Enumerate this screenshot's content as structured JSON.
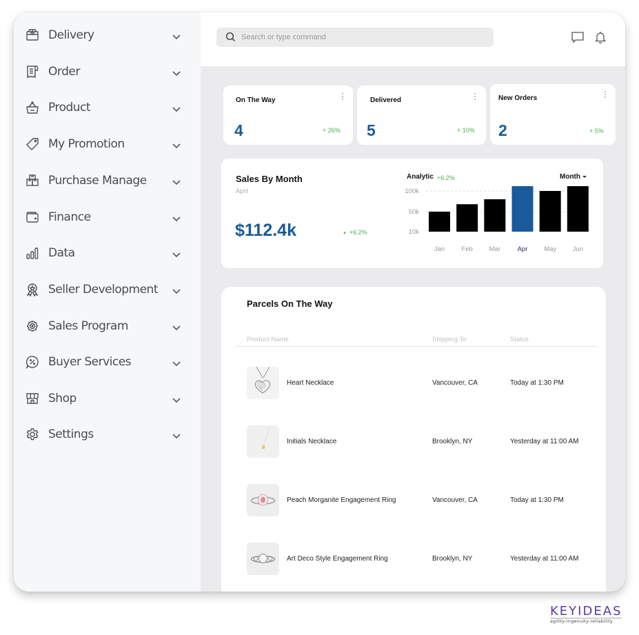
{
  "sidebar": {
    "items": [
      {
        "label": "Delivery",
        "icon": "box-icon"
      },
      {
        "label": "Order",
        "icon": "receipt-icon"
      },
      {
        "label": "Product",
        "icon": "basket-icon"
      },
      {
        "label": "My Promotion",
        "icon": "tag-icon"
      },
      {
        "label": "Purchase Manage",
        "icon": "boxes-icon"
      },
      {
        "label": "Finance",
        "icon": "wallet-icon"
      },
      {
        "label": "Data",
        "icon": "bar-chart-icon"
      },
      {
        "label": "Seller Development",
        "icon": "badge-icon"
      },
      {
        "label": "Sales Program",
        "icon": "target-gear-icon"
      },
      {
        "label": "Buyer Services",
        "icon": "percent-chat-icon"
      },
      {
        "label": "Shop",
        "icon": "store-icon"
      },
      {
        "label": "Settings",
        "icon": "gear-icon"
      }
    ]
  },
  "topbar": {
    "search_placeholder": "Search or type command"
  },
  "stats": [
    {
      "title": "On The Way",
      "value": "4",
      "change": "+ 26%"
    },
    {
      "title": "Delivered",
      "value": "5",
      "change": "+ 10%"
    },
    {
      "title": "New Orders",
      "value": "2",
      "change": "+ 5%"
    }
  ],
  "sales": {
    "title": "Sales By Month",
    "subtitle": "April",
    "value": "$112.4k",
    "change": "+6.2%",
    "analytic_label": "Analytic",
    "analytic_change": "+6.2%",
    "period": "Month"
  },
  "chart_data": {
    "type": "bar",
    "title": "Analytic",
    "categories": [
      "Jan",
      "Feb",
      "Mar",
      "Apr",
      "May",
      "Jun"
    ],
    "values": [
      50,
      68,
      80,
      115,
      100,
      115
    ],
    "unit": "k",
    "highlight": "Apr",
    "y_ticks": [
      "10k",
      "50k",
      "100k"
    ],
    "y_tick_values": [
      10,
      50,
      100
    ],
    "ylim": [
      10,
      115
    ],
    "grid": "dashed at 50k and 100k",
    "colors": {
      "bar": "#000000",
      "highlight": "#1a5a9a",
      "highlight_label": "#2a2a6a"
    }
  },
  "parcels": {
    "title": "Parcels On The Way",
    "columns": [
      "Product Name",
      "Shipping To",
      "Status"
    ],
    "rows": [
      {
        "product": "Heart Necklace",
        "shipping_to": "Vancouver, CA",
        "status": "Today at 1:30 PM",
        "thumb": "heart-necklace"
      },
      {
        "product": "Initials Necklace",
        "shipping_to": "Brooklyn, NY",
        "status": "Yesterday at 11:00 AM",
        "thumb": "initials-necklace"
      },
      {
        "product": "Peach Morganite Engagement Ring",
        "shipping_to": "Vancouver, CA",
        "status": "Today at 1:30 PM",
        "thumb": "morganite-ring"
      },
      {
        "product": "Art Deco Style Engagement Ring",
        "shipping_to": "Brooklyn, NY",
        "status": "Yesterday at 11:00 AM",
        "thumb": "art-deco-ring"
      }
    ]
  },
  "brand": {
    "name": "KEYIDEAS",
    "tagline": "agility-ingenuity-reliability",
    "color": "#5b3aa0"
  },
  "colors": {
    "accent": "#1a5a9a",
    "positive": "#4caf50"
  }
}
